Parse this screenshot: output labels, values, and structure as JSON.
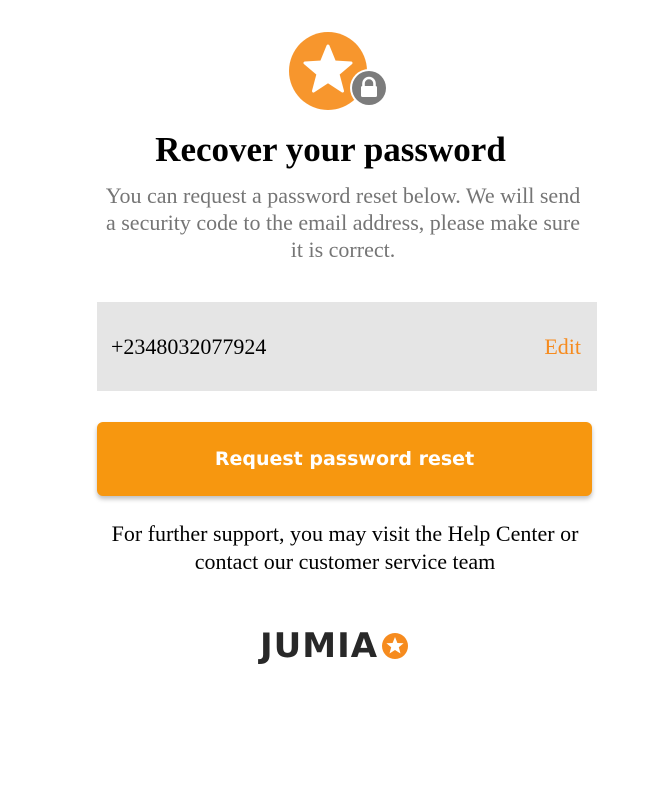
{
  "header": {
    "icon": "star-lock-icon",
    "title": "Recover your password",
    "subtitle": "You can request a password reset below. We will send a security code to the email address, please make sure it is correct."
  },
  "account": {
    "value": "+2348032077924",
    "edit_label": "Edit"
  },
  "actions": {
    "reset_label": "Request password reset"
  },
  "support": {
    "text": "For further support, you may visit the Help Center or contact our customer service team"
  },
  "footer": {
    "brand": "JUMIA",
    "brand_icon": "star-icon"
  },
  "colors": {
    "accent": "#f68b1e",
    "button": "#f7970f",
    "field_bg": "#e5e5e5",
    "muted_text": "#757575"
  }
}
